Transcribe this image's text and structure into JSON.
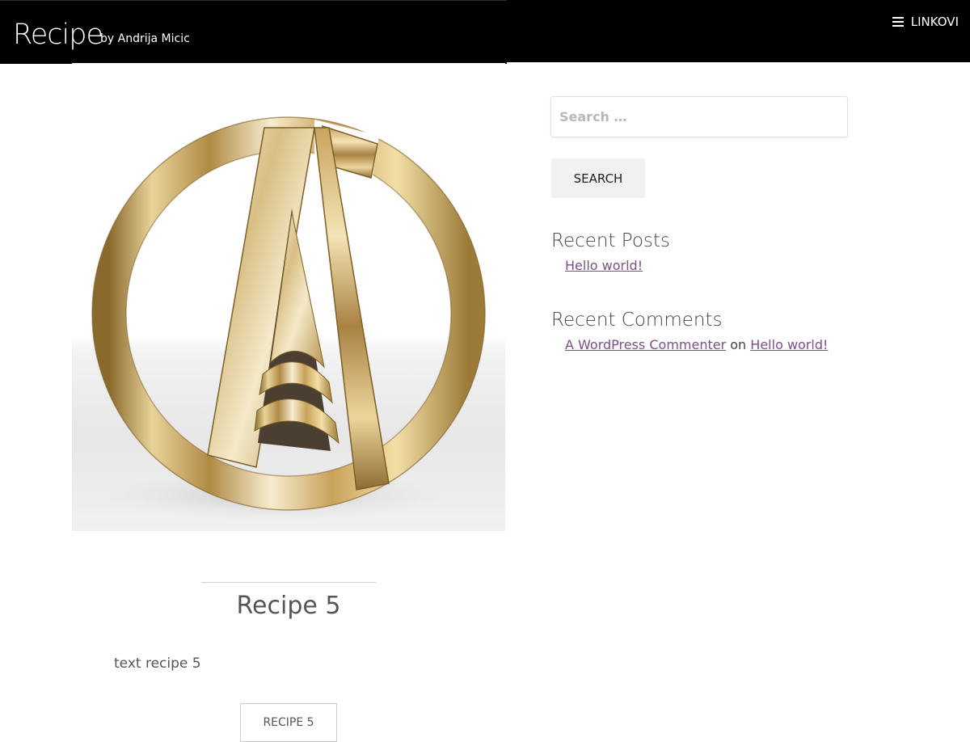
{
  "header": {
    "site_title": "Recipe",
    "site_description": "by Andrija Micic",
    "menu_label": "LINKOVI",
    "background_color": "#000000"
  },
  "featured_image": {
    "icon": "gold-circle-a-logo"
  },
  "entry": {
    "title": "Recipe 5",
    "excerpt": "text recipe 5",
    "button_label": "RECIPE 5"
  },
  "sidebar": {
    "search": {
      "placeholder": "Search …",
      "button_label": "SEARCH"
    },
    "recent_posts": {
      "title": "Recent Posts",
      "items": [
        {
          "label": "Hello world!"
        }
      ]
    },
    "recent_comments": {
      "title": "Recent Comments",
      "items": [
        {
          "author": "A WordPress Commenter",
          "connector": "on",
          "post": "Hello world!"
        }
      ]
    }
  },
  "colors": {
    "link": "#7b4f8a",
    "gold": "#d4b46a"
  }
}
